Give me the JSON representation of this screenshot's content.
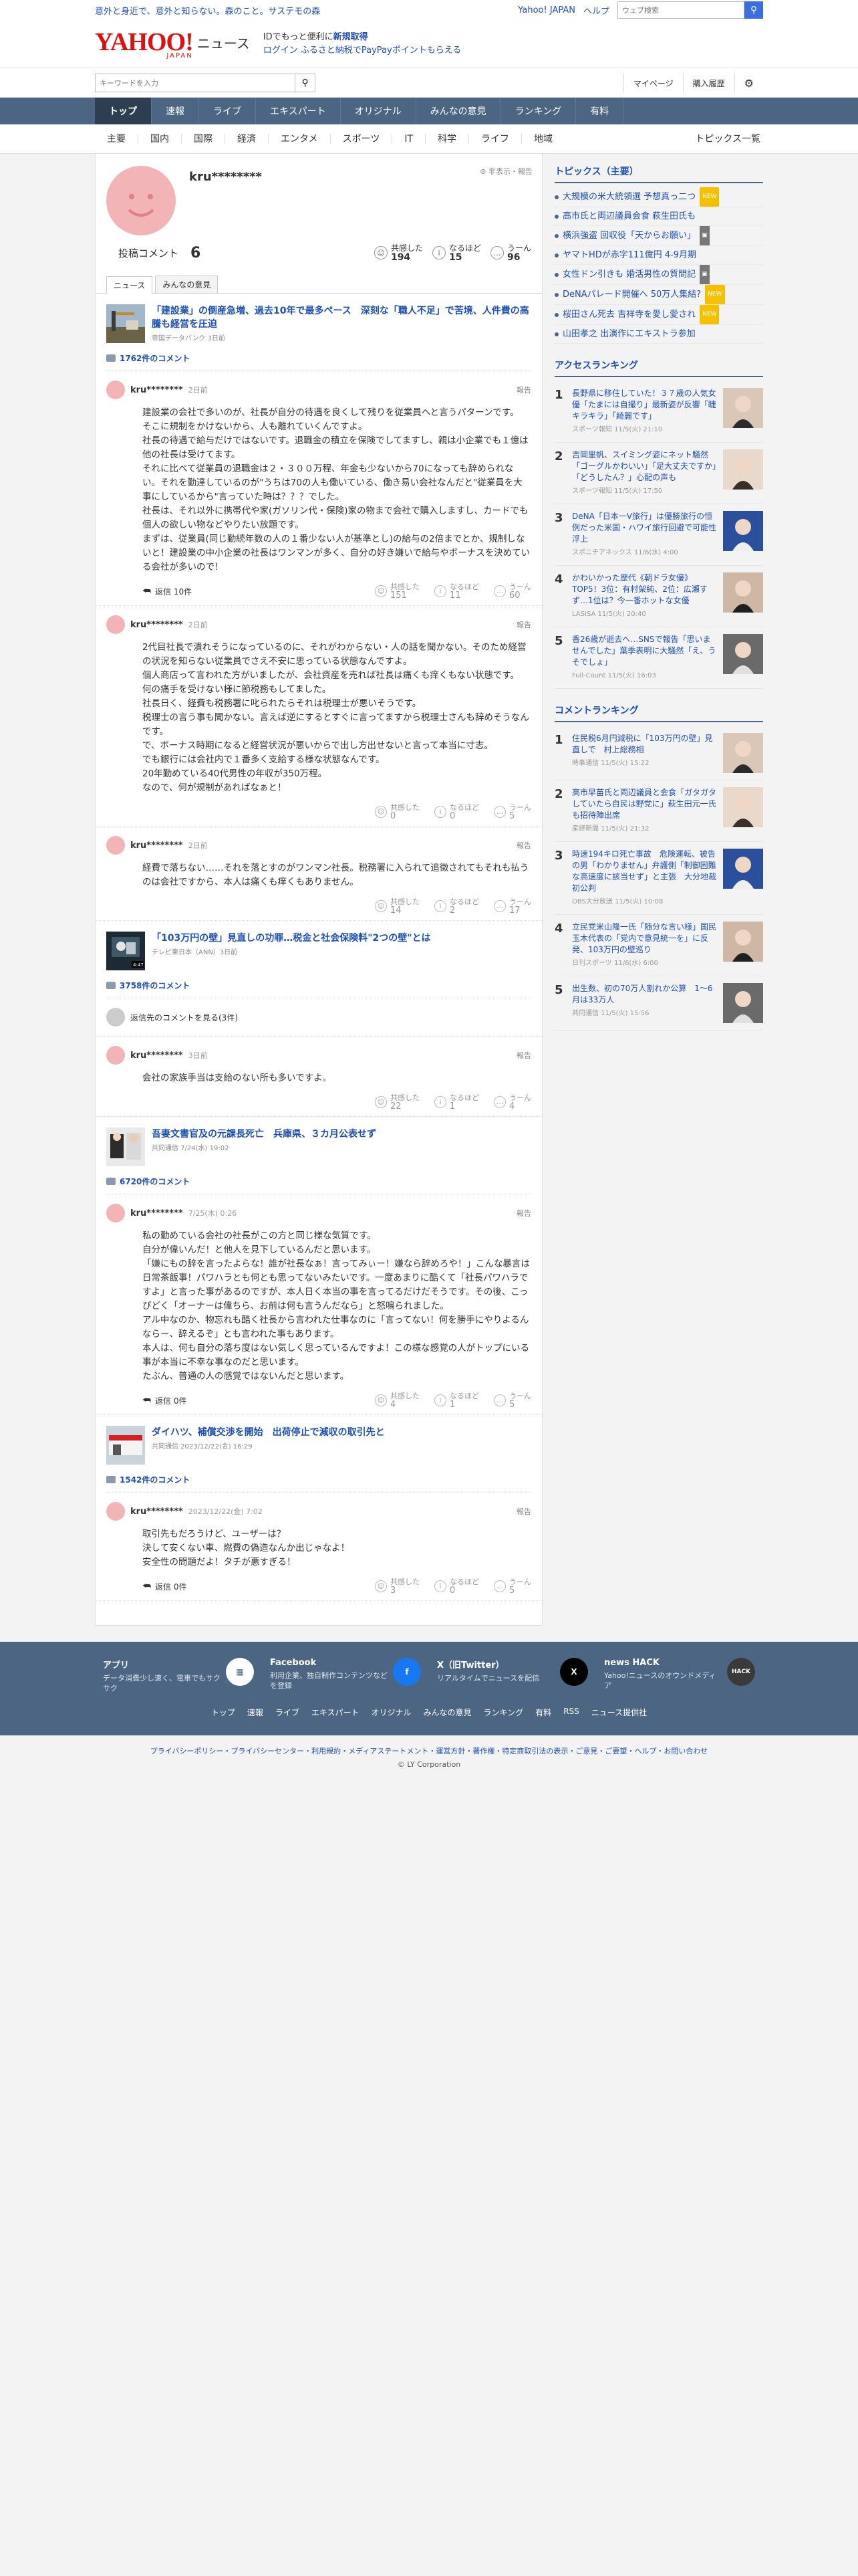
{
  "promo": "意外と身近で、意外と知らない。森のこと。サステモの森",
  "topright": {
    "yahoo": "Yahoo! JAPAN",
    "help": "ヘルプ",
    "search_placeholder": "ウェブ検索"
  },
  "logo": {
    "main": "YAHOO!",
    "sub": "JAPAN",
    "news": "ニュース"
  },
  "login": {
    "line1_pre": "IDでもっと便利に",
    "line1_link": "新規取得",
    "line2": "ログイン  ふるさと納税でPayPayポイントもらえる"
  },
  "search": {
    "placeholder": "キーワードを入力",
    "mypage": "マイページ",
    "history": "購入履歴"
  },
  "catnav": [
    "トップ",
    "速報",
    "ライブ",
    "エキスパート",
    "オリジナル",
    "みんなの意見",
    "ランキング",
    "有料"
  ],
  "subnav": [
    "主要",
    "国内",
    "国際",
    "経済",
    "エンタメ",
    "スポーツ",
    "IT",
    "科学",
    "ライフ",
    "地域"
  ],
  "subnav_more": "トピックス一覧",
  "profile": {
    "name": "kru********",
    "report": "非表示・報告",
    "count_label": "投稿コメント",
    "count": "6",
    "reacts": [
      {
        "label": "共感した",
        "n": "194"
      },
      {
        "label": "なるほど",
        "n": "15"
      },
      {
        "label": "うーん",
        "n": "96"
      }
    ]
  },
  "tabs": [
    "ニュース",
    "みんなの意見"
  ],
  "reply_label": "返信",
  "others": "返信先のコメントを見る(3件)",
  "articles": [
    {
      "title": "「建設業」の倒産急増、過去10年で最多ペース　深刻な「職人不足」で苦境、人件費の高騰も経営を圧迫",
      "meta": "帝国データバンク 3日前",
      "ccount": "1762件のコメント",
      "comments": [
        {
          "name": "kru********",
          "time": "2日前",
          "report": "報告",
          "body": "建設業の会社で多いのが、社長が自分の待遇を良くして残りを従業員へと言うパターンです。\nそこに規制をかけないから、人も離れていくんですよ。\n社長の待遇で給与だけではないです。退職金の積立を保険でしてますし、親は小企業でも１億は他の社長は受けてます。\nそれに比べて従業員の退職金は２・３００万程、年金も少ないから70になっても辞められない。それを勤達しているのが\"うちは70の人も働いている、働き易い会社なんだと\"従業員を大事にしているから\"言っていた時は？？？でした。\n社長は、それ以外に携帯代や家(ガソリン代・保険)家の物まで会社で購入しますし、カードでも\n個人の欲しい物などやりたい放題です。\nまずは、従業員(同じ勤続年数の人の１番少ない人が基準とし)の給与の2倍までとか、規制しないと！建設業の中小企業の社長はワンマンが多く、自分の好き嫌いで給与やボーナスを決めている会社が多いので！",
          "reply": "返信 10件",
          "r": [
            "151",
            "11",
            "60"
          ]
        },
        {
          "name": "kru********",
          "time": "2日前",
          "report": "報告",
          "body": "2代目社長で潰れそうになっているのに、それがわからない・人の話を聞かない。そのため経営の状況を知らない従業員でさえ不安に思っている状態なんですよ。\n個人商店って言われた方がいましたが、会社資産を売れば社長は痛くも痒くもない状態です。\n何の痛手を受けない様に節税務もしてました。\n社長日く、経費も税務署に叱られたらそれは税理士が悪いそうです。\n税理士の言う事も聞かない。言えば逆にするとすぐに言ってますから税理士さんも辞めそうなんです。\nで、ボーナス時期になると経営状況が悪いからで出し方出せないと言って本当に寸志。\nでも銀行には会社内で１番多く支給する様な状態なんです。\n20年勤めている40代男性の年収が350万程。\nなので、何が規制があればなぁと！",
          "reply": "",
          "r": [
            "0",
            "0",
            "5"
          ]
        },
        {
          "name": "kru********",
          "time": "2日前",
          "report": "報告",
          "body": "経費で落ちない……それを落とすのがワンマン社長。税務署に入られて追徴されてもそれも払うのは会社ですから、本人は痛くも痒くもありません。",
          "reply": "",
          "r": [
            "14",
            "2",
            "17"
          ]
        }
      ]
    },
    {
      "title": "「103万円の壁」見直しの功罪…税金と社会保険料\"2つの壁\"とは",
      "meta": "テレビ東日本（ANN）3日前",
      "ccount": "3758件のコメント",
      "comments": [
        {
          "name": "kru********",
          "time": "3日前",
          "report": "報告",
          "body": "会社の家族手当は支給のない所も多いですよ。",
          "reply": "",
          "r": [
            "22",
            "1",
            "4"
          ]
        }
      ]
    },
    {
      "title": "吾妻文書官及の元課長死亡　兵庫県、３カ月公表せず",
      "meta": "共同通信 7/24(水) 19:02",
      "ccount": "6720件のコメント",
      "comments": [
        {
          "name": "kru********",
          "time": "7/25(木) 0:26",
          "report": "報告",
          "body": "私の勤めている会社の社長がこの方と同じ様な気質です。\n自分が偉いんだ！と他人を見下しているんだと思います。\n「嫌にもの辞を言ったよらな！誰が社長なぁ！言ってみぃー！嫌なら辞めろや！」こんな暴言は日常茶飯事！パワハラとも何とも思ってないみたいです。一度あまりに酷くて「社長パワハラですよ」と言った事があるのですが、本人日く本当の事を言ってるだけだそうです。その後、こっぴどく「オーナーは偉ちら、お前は何も言うんだなら」と怒鳴られました。\nアル中なのか、物忘れも酷く社長から言われた仕事なのに「言ってない！何を勝手にやりよるんならー、辞えるぞ」とも言われた事もあります。\n本人は、何も自分の落ち度はない気しく思っているんですよ！この様な感覚の人がトップにいる事が本当に不幸な事なのだと思います。\nたぶん、普通の人の感覚ではないんだと思います。",
          "reply": "返信 0件",
          "r": [
            "4",
            "1",
            "5"
          ]
        }
      ]
    },
    {
      "title": "ダイハツ、補償交渉を開始　出荷停止で減収の取引先と",
      "meta": "共同通信 2023/12/22(金) 16:29",
      "ccount": "1542件のコメント",
      "comments": [
        {
          "name": "kru********",
          "time": "2023/12/22(金) 7:02",
          "report": "報告",
          "body": "取引先もだろうけど、ユーザーは？\n決して安くない車、燃費の偽造なんか出じゃなよ！\n安全性の問題だよ！タチが悪すぎる！",
          "reply": "返信 0件",
          "r": [
            "3",
            "0",
            "5"
          ]
        }
      ]
    }
  ],
  "topics": {
    "title": "トピックス（主要）",
    "items": [
      {
        "t": "大規模の米大統領選 予想真っ二つ",
        "b": "new"
      },
      {
        "t": "高市氏と両辺議員会食 萩生田氏も",
        "b": ""
      },
      {
        "t": "横浜強盗 回収役「天からお願い」",
        "b": "cam"
      },
      {
        "t": "ヤマトHDが赤字111億円 4-9月期",
        "b": ""
      },
      {
        "t": "女性ドン引きも 婚活男性の質問記",
        "b": "cam"
      },
      {
        "t": "DeNAパレード開催へ 50万人集結?",
        "b": "new"
      },
      {
        "t": "桜田さん死去 吉祥寺を愛し愛され",
        "b": "new"
      },
      {
        "t": "山田孝之 出演作にエキストラ参加",
        "b": ""
      }
    ]
  },
  "access": {
    "title": "アクセスランキング",
    "items": [
      {
        "t": "長野県に移住していた！３７歳の人気女優「たまには自撮り」最新姿が反響「睫キラキラ」「綺麗です」",
        "s": "スポーツ報知 11/5(火) 21:10"
      },
      {
        "t": "吉岡里帆、スイミング姿にネット騒然「ゴーグルかわいい」「足大丈夫ですか」「どうしたん？」心配の声も",
        "s": "スポーツ報知 11/5(火) 17:50"
      },
      {
        "t": "DeNA「日本一V旅行」は優勝旅行の恒例だった米国・ハワイ旅行回避で可能性浮上",
        "s": "スポニチアネックス 11/6(水) 4:00"
      },
      {
        "t": "かわいかった歴代《朝ドラ女優》TOP5！3位：有村架純、2位：広瀬すず…1位は？今一番ホットな女優",
        "s": "LASISA 11/5(火) 20:40"
      },
      {
        "t": "香26歳が逝去へ…SNSで報告「思いませんでした」葉季表明に大騒然「え、うそでしょ」",
        "s": "Full-Count 11/5(火) 16:03"
      }
    ]
  },
  "crank": {
    "title": "コメントランキング",
    "items": [
      {
        "t": "住民税6月円減税に「103万円の壁」見直しで　村上総務相",
        "s": "時事通信 11/5(火) 15:22"
      },
      {
        "t": "高市早苗氏と両辺議員と会食「ガタガタしていたら自民は野党に」萩生田元一氏も招待陣出席",
        "s": "産経新聞 11/5(火) 21:32"
      },
      {
        "t": "時速194キロ死亡事故　危険運転、被告の男「わかりません」弁護側「制御困難な高速度に該当せず」と主張　大分地裁初公判",
        "s": "OBS大分放送 11/5(火) 10:08"
      },
      {
        "t": "立民党米山隆一氏「随分な言い様」国民玉木代表の「党内で意見統一を」に反発、103万円の壁巡り",
        "s": "日刊スポーツ 11/6(水) 6:00"
      },
      {
        "t": "出生数、初の70万人割れか公算　1～6月は33万人",
        "s": "共同通信 11/5(火) 15:56"
      }
    ]
  },
  "footer": {
    "cards": [
      {
        "t": "アプリ",
        "d": "データ消費少し速く、電車でもサクサク",
        "ic": "app-icon"
      },
      {
        "t": "Facebook",
        "d": "利用企業、独自制作コンテンツなどを登録",
        "ic": "facebook-icon"
      },
      {
        "t": "X（旧Twitter）",
        "d": "リアルタイムでニュースを配信",
        "ic": "x-icon"
      },
      {
        "t": "news HACK",
        "d": "Yahoo!ニュースのオウンドメディア",
        "ic": "newshack-icon"
      }
    ],
    "links": [
      "トップ",
      "速報",
      "ライブ",
      "エキスパート",
      "オリジナル",
      "みんなの意見",
      "ランキング",
      "有料",
      "RSS",
      "ニュース提供社"
    ]
  },
  "bottom": {
    "links": "プライバシーポリシー・プライバシーセンター・利用規約・メディアステートメント・運営方針・著作権・特定商取引法の表示・ご意見・ご要望・ヘルプ・お問い合わせ",
    "copy": "© LY Corporation"
  },
  "colors": {
    "brand": "#ff0033",
    "link": "#1f4fb5",
    "nav": "#4b6582",
    "avatar": "#f3b4b8"
  }
}
